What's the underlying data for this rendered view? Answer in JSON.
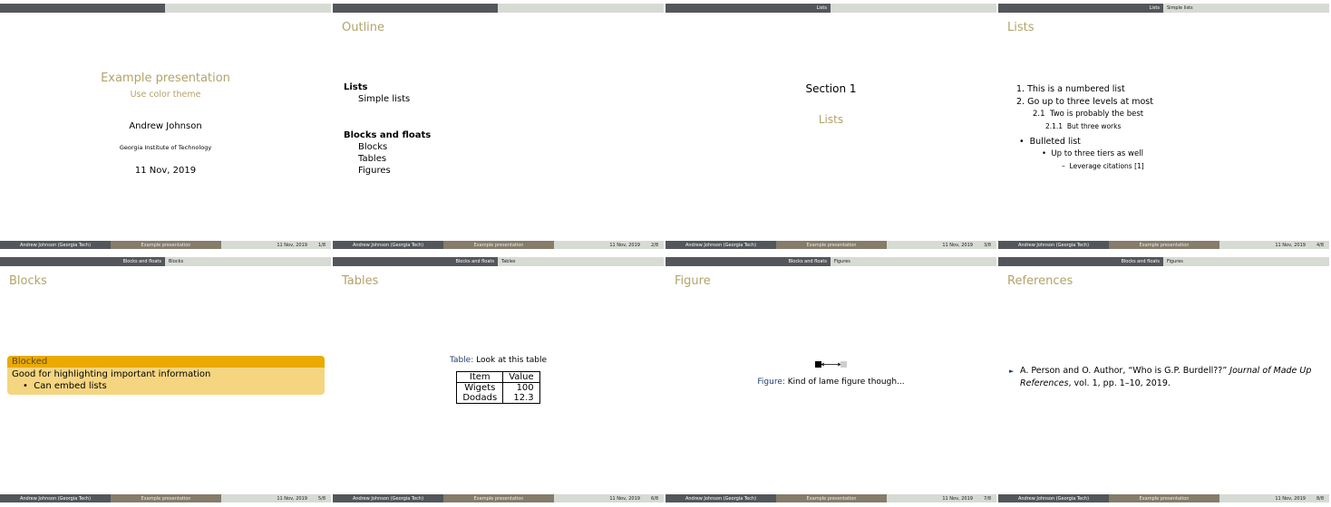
{
  "footer": {
    "author": "Andrew Johnson  (Georgia Tech)",
    "title": "Example presentation",
    "date": "11 Nov, 2019",
    "total_pages": "8"
  },
  "slides": [
    {
      "page": "1/8",
      "header": {
        "section": "",
        "subsection": ""
      },
      "title": "Example presentation",
      "subtitle": "Use color theme",
      "author": "Andrew Johnson",
      "institute": "Georgia Institute of Technology",
      "date": "11 Nov, 2019"
    },
    {
      "page": "2/8",
      "header": {
        "section": "",
        "subsection": ""
      },
      "frame_title": "Outline",
      "outline": [
        {
          "section": "Lists",
          "subsections": [
            "Simple lists"
          ]
        },
        {
          "section": "Blocks and floats",
          "subsections": [
            "Blocks",
            "Tables",
            "Figures"
          ]
        }
      ]
    },
    {
      "page": "3/8",
      "header": {
        "section": "Lists",
        "subsection": ""
      },
      "section_label": "Section 1",
      "section_name": "Lists"
    },
    {
      "page": "4/8",
      "header": {
        "section": "Lists",
        "subsection": "Simple lists"
      },
      "frame_title": "Lists",
      "items": [
        {
          "marker": "1.",
          "text": "This is a numbered list"
        },
        {
          "marker": "2.",
          "text": "Go up to three levels at most"
        },
        {
          "marker": "2.1",
          "text": "Two is probably the best"
        },
        {
          "marker": "2.1.1",
          "text": "But three works"
        },
        {
          "marker": "•",
          "text": "Bulleted list"
        },
        {
          "marker": "•",
          "text": "Up to three tiers as well"
        },
        {
          "marker": "–",
          "text": "Leverage citations [1]"
        }
      ]
    },
    {
      "page": "5/8",
      "header": {
        "section": "Blocks and floats",
        "subsection": "Blocks"
      },
      "frame_title": "Blocks",
      "block": {
        "title": "Blocked",
        "body": "Good for highlighting important information",
        "bullet": "Can embed lists"
      }
    },
    {
      "page": "6/8",
      "header": {
        "section": "Blocks and floats",
        "subsection": "Tables"
      },
      "frame_title": "Tables",
      "caption_label": "Table:",
      "caption": "Look at this table",
      "table": {
        "headers": [
          "Item",
          "Value"
        ],
        "rows": [
          [
            "Wigets",
            "100"
          ],
          [
            "Dodads",
            "12.3"
          ]
        ]
      }
    },
    {
      "page": "7/8",
      "header": {
        "section": "Blocks and floats",
        "subsection": "Figures"
      },
      "frame_title": "Figure",
      "caption_label": "Figure:",
      "caption": "Kind of lame figure though..."
    },
    {
      "page": "8/8",
      "header": {
        "section": "Blocks and floats",
        "subsection": "Figures"
      },
      "frame_title": "References",
      "reference": {
        "authors": "A. Person and O. Author, “Who is G.P. Burdell??”",
        "journal": "Journal of Made Up References",
        "details": ", vol. 1, pp. 1–10, 2019."
      }
    }
  ]
}
